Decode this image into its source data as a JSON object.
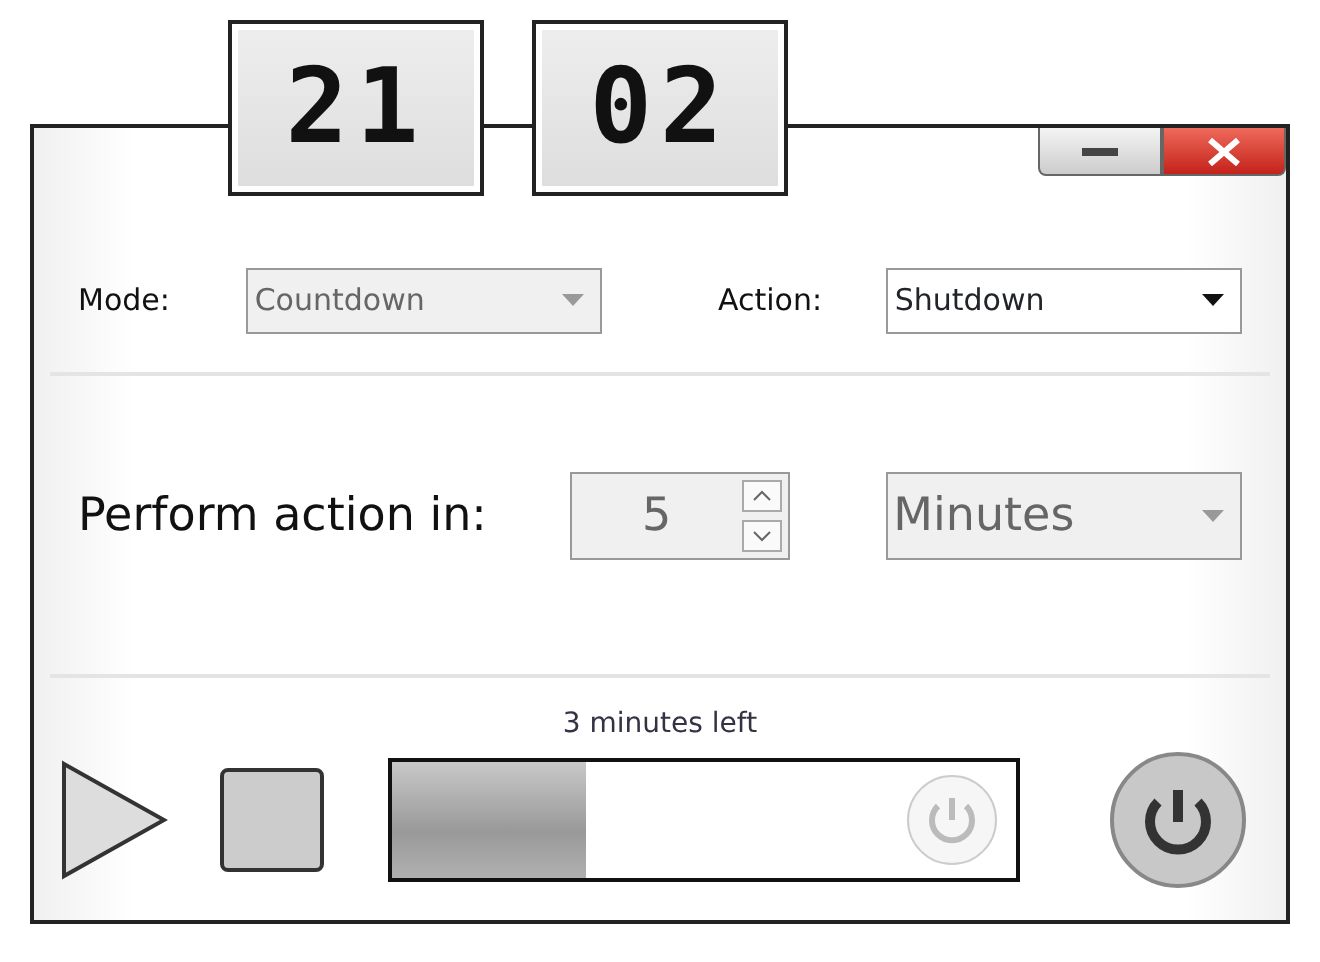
{
  "clock": {
    "hours": "21",
    "minutes": "02"
  },
  "mode": {
    "label": "Mode:",
    "value": "Countdown",
    "disabled": true
  },
  "action": {
    "label": "Action:",
    "value": "Shutdown",
    "disabled": false
  },
  "delay": {
    "label": "Perform action in:",
    "value": "5",
    "disabled": true
  },
  "unit": {
    "value": "Minutes",
    "disabled": true
  },
  "status": "3 minutes left",
  "progress": {
    "level": 0.31
  }
}
